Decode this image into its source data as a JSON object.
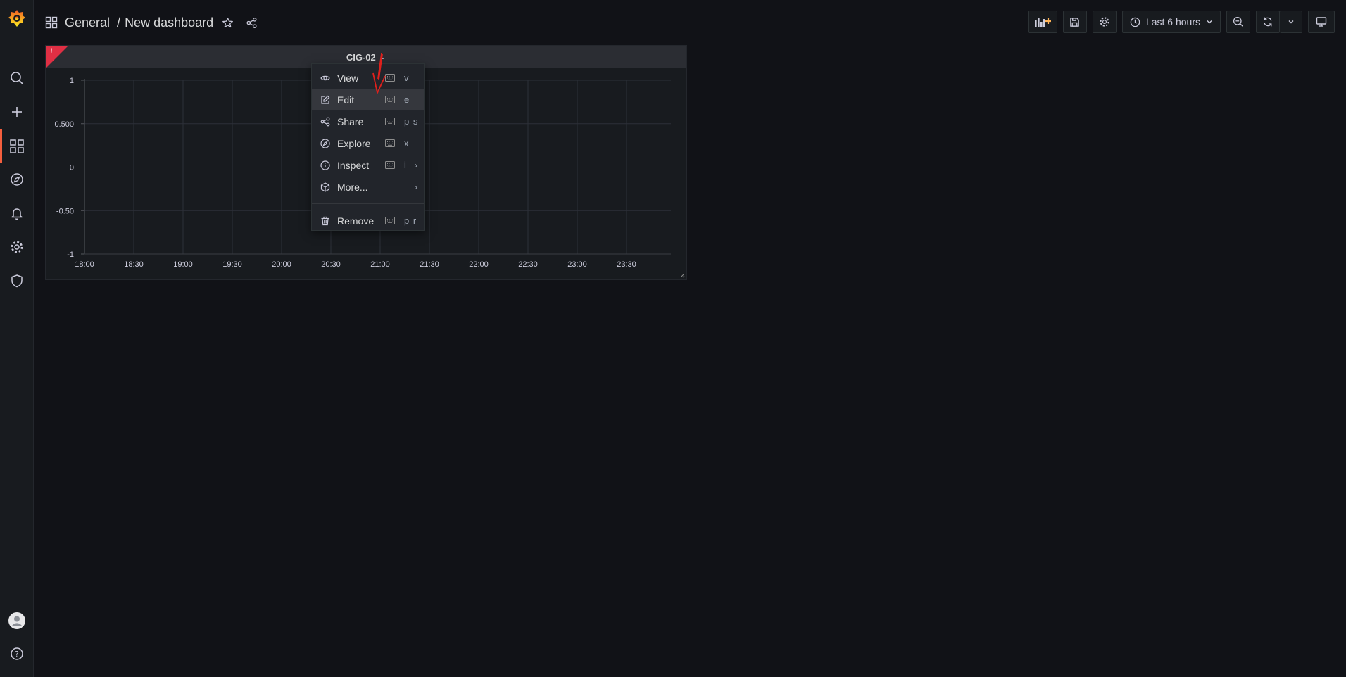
{
  "sidemenu": {
    "items": [
      {
        "icon": "search-icon"
      },
      {
        "icon": "plus-icon"
      },
      {
        "icon": "dashboards-icon"
      },
      {
        "icon": "explore-compass-icon"
      },
      {
        "icon": "alerting-bell-icon"
      },
      {
        "icon": "configuration-gear-icon"
      },
      {
        "icon": "server-admin-shield-icon"
      }
    ],
    "bottom": [
      {
        "icon": "user-avatar-icon"
      },
      {
        "icon": "help-icon"
      }
    ],
    "active_color": "#f55f3e"
  },
  "breadcrumb": {
    "folder": "General",
    "separator": "/",
    "title": "New dashboard"
  },
  "toolbar": {
    "time_range": "Last 6 hours",
    "icons": [
      "add-panel-icon",
      "save-icon",
      "settings-icon",
      "clock-icon",
      "zoom-out-icon",
      "refresh-icon",
      "chevron-down-icon",
      "tv-mode-icon"
    ]
  },
  "panel": {
    "title": "CIG-02",
    "error_mark": "!",
    "error_color": "#e02f44"
  },
  "chart_data": {
    "type": "line",
    "title": "CIG-02",
    "x_ticks": [
      "18:00",
      "18:30",
      "19:00",
      "19:30",
      "20:00",
      "20:30",
      "21:00",
      "21:30",
      "22:00",
      "22:30",
      "23:00",
      "23:30"
    ],
    "y_ticks": [
      "1",
      "0.500",
      "0",
      "-0.50",
      "-1"
    ],
    "ylim": [
      -1,
      1
    ],
    "series": [],
    "grid": true
  },
  "context_menu": {
    "items": [
      {
        "icon": "eye-icon",
        "label": "View",
        "shortcut": "v",
        "submenu": false
      },
      {
        "icon": "edit-icon",
        "label": "Edit",
        "shortcut": "e",
        "submenu": false,
        "highlighted": true
      },
      {
        "icon": "share-icon",
        "label": "Share",
        "shortcut": "p s",
        "submenu": false
      },
      {
        "icon": "compass-icon",
        "label": "Explore",
        "shortcut": "x",
        "submenu": false
      },
      {
        "icon": "info-circle-icon",
        "label": "Inspect",
        "shortcut": "i",
        "submenu": true
      },
      {
        "icon": "cube-icon",
        "label": "More...",
        "shortcut": "",
        "submenu": true
      }
    ],
    "remove": {
      "icon": "trash-icon",
      "label": "Remove",
      "shortcut": "p r"
    },
    "submenu_glyph": "›"
  }
}
